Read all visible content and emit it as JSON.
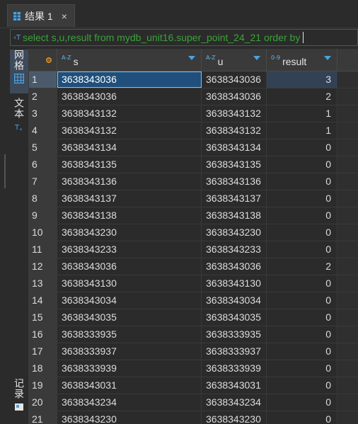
{
  "tab": {
    "title": "结果 1",
    "close": "×"
  },
  "query": {
    "icon": "‹T",
    "text": "select s,u,result from mydb_unit16.super_point_24_21 order by"
  },
  "sidebar": {
    "items": [
      {
        "label": "网格",
        "icon": "grid-icon"
      },
      {
        "label": "文本",
        "icon": "text-icon"
      },
      {
        "label": "记录",
        "icon": "record-icon"
      }
    ]
  },
  "columns": [
    {
      "type": "A-Z",
      "name": "s"
    },
    {
      "type": "A-Z",
      "name": "u"
    },
    {
      "type": "0-9",
      "name": "result"
    }
  ],
  "rows": [
    {
      "n": "1",
      "s": "3638343036",
      "u": "3638343036",
      "result": "3"
    },
    {
      "n": "2",
      "s": "3638343036",
      "u": "3638343036",
      "result": "2"
    },
    {
      "n": "3",
      "s": "3638343132",
      "u": "3638343132",
      "result": "1"
    },
    {
      "n": "4",
      "s": "3638343132",
      "u": "3638343132",
      "result": "1"
    },
    {
      "n": "5",
      "s": "3638343134",
      "u": "3638343134",
      "result": "0"
    },
    {
      "n": "6",
      "s": "3638343135",
      "u": "3638343135",
      "result": "0"
    },
    {
      "n": "7",
      "s": "3638343136",
      "u": "3638343136",
      "result": "0"
    },
    {
      "n": "8",
      "s": "3638343137",
      "u": "3638343137",
      "result": "0"
    },
    {
      "n": "9",
      "s": "3638343138",
      "u": "3638343138",
      "result": "0"
    },
    {
      "n": "10",
      "s": "3638343230",
      "u": "3638343230",
      "result": "0"
    },
    {
      "n": "11",
      "s": "3638343233",
      "u": "3638343233",
      "result": "0"
    },
    {
      "n": "12",
      "s": "3638343036",
      "u": "3638343036",
      "result": "2"
    },
    {
      "n": "13",
      "s": "3638343130",
      "u": "3638343130",
      "result": "0"
    },
    {
      "n": "14",
      "s": "3638343034",
      "u": "3638343034",
      "result": "0"
    },
    {
      "n": "15",
      "s": "3638343035",
      "u": "3638343035",
      "result": "0"
    },
    {
      "n": "16",
      "s": "3638333935",
      "u": "3638333935",
      "result": "0"
    },
    {
      "n": "17",
      "s": "3638333937",
      "u": "3638333937",
      "result": "0"
    },
    {
      "n": "18",
      "s": "3638333939",
      "u": "3638333939",
      "result": "0"
    },
    {
      "n": "19",
      "s": "3638343031",
      "u": "3638343031",
      "result": "0"
    },
    {
      "n": "20",
      "s": "3638343234",
      "u": "3638343234",
      "result": "0"
    },
    {
      "n": "21",
      "s": "3638343230",
      "u": "3638343230",
      "result": "0"
    }
  ],
  "colors": {
    "accent": "#4aa3e0",
    "selection": "#1f4f7a",
    "query_text": "#3aa33a"
  }
}
